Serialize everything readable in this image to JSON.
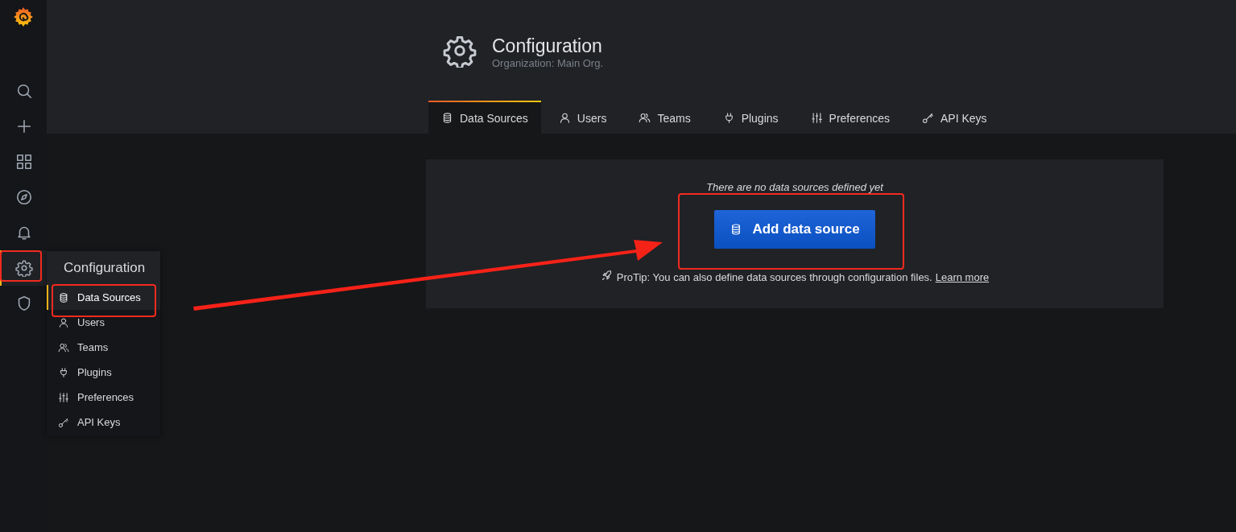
{
  "sidebar": {
    "items": [
      {
        "kind": "search",
        "selected": false
      },
      {
        "kind": "plus",
        "selected": false
      },
      {
        "kind": "apps",
        "selected": false
      },
      {
        "kind": "compass",
        "selected": false
      },
      {
        "kind": "bell",
        "selected": false
      },
      {
        "kind": "gear",
        "selected": true
      },
      {
        "kind": "shield",
        "selected": false
      }
    ]
  },
  "menu": {
    "title": "Configuration",
    "items": [
      {
        "kind": "database",
        "label": "Data Sources",
        "selected": true
      },
      {
        "kind": "user",
        "label": "Users",
        "selected": false
      },
      {
        "kind": "users",
        "label": "Teams",
        "selected": false
      },
      {
        "kind": "plug",
        "label": "Plugins",
        "selected": false
      },
      {
        "kind": "sliders",
        "label": "Preferences",
        "selected": false
      },
      {
        "kind": "key",
        "label": "API Keys",
        "selected": false
      }
    ]
  },
  "header": {
    "title": "Configuration",
    "subtitle": "Organization: Main Org."
  },
  "tabs": [
    {
      "kind": "database",
      "label": "Data Sources",
      "selected": true
    },
    {
      "kind": "user",
      "label": "Users",
      "selected": false
    },
    {
      "kind": "users",
      "label": "Teams",
      "selected": false
    },
    {
      "kind": "plug",
      "label": "Plugins",
      "selected": false
    },
    {
      "kind": "sliders",
      "label": "Preferences",
      "selected": false
    },
    {
      "kind": "key",
      "label": "API Keys",
      "selected": false
    }
  ],
  "empty_state": {
    "message": "There are no data sources defined yet",
    "button": "Add data source",
    "protip": "ProTip: You can also define data sources through configuration files.",
    "link": "Learn more"
  }
}
